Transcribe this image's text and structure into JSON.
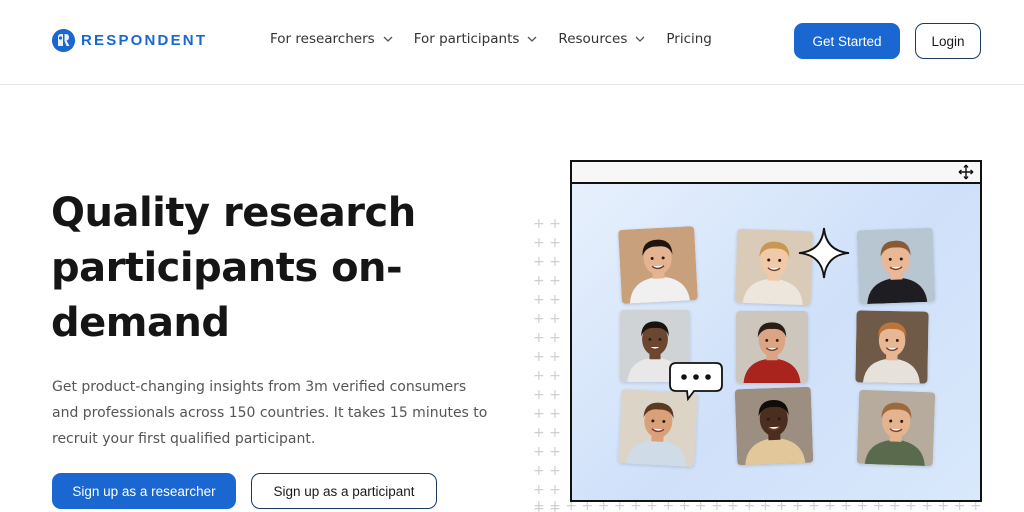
{
  "brand": {
    "name": "RESPONDENT",
    "color": "#1a67d2"
  },
  "nav": {
    "items": [
      {
        "label": "For researchers",
        "has_dropdown": true
      },
      {
        "label": "For participants",
        "has_dropdown": true
      },
      {
        "label": "Resources",
        "has_dropdown": true
      },
      {
        "label": "Pricing",
        "has_dropdown": false
      }
    ],
    "get_started": "Get Started",
    "login": "Login"
  },
  "hero": {
    "title_line1": "Quality research",
    "title_line2": "participants on-",
    "title_line3": "demand",
    "subtitle": "Get product-changing insights from 3m verified consumers and professionals across 150 countries. It takes 15 minutes to recruit your first qualified participant.",
    "cta_researcher": "Sign up as a researcher",
    "cta_participant": "Sign up as a participant"
  },
  "illustration": {
    "participants": [
      {
        "name": "participant-photo-1",
        "skin": "#e3b48f",
        "hair": "#1f140e",
        "shirt": "#f0f0f0",
        "bg": "#c9a07c"
      },
      {
        "name": "participant-photo-2",
        "skin": "#f0c9a8",
        "hair": "#c9974f",
        "shirt": "#ede6dc",
        "bg": "#d9cbb8"
      },
      {
        "name": "participant-photo-3",
        "skin": "#e9b896",
        "hair": "#8a5a34",
        "shirt": "#1e1e22",
        "bg": "#b8c6d2"
      },
      {
        "name": "participant-photo-4",
        "skin": "#6b4630",
        "hair": "#1a1410",
        "shirt": "#e8e8e8",
        "bg": "#cfd3d6"
      },
      {
        "name": "participant-photo-5",
        "skin": "#dba483",
        "hair": "#2a1d14",
        "shirt": "#a8241d",
        "bg": "#cdc6bd"
      },
      {
        "name": "participant-photo-6",
        "skin": "#e9b693",
        "hair": "#b9753b",
        "shirt": "#e6e1da",
        "bg": "#6f5a48"
      },
      {
        "name": "participant-photo-7",
        "skin": "#d9a079",
        "hair": "#5a3a22",
        "shirt": "#cfdbe6",
        "bg": "#dcd4c6"
      },
      {
        "name": "participant-photo-8",
        "skin": "#4a2e1f",
        "hair": "#120c08",
        "shirt": "#e2c79a",
        "bg": "#9c8f82"
      },
      {
        "name": "participant-photo-9",
        "skin": "#e6b38f",
        "hair": "#9c6a3c",
        "shirt": "#5a6a4c",
        "bg": "#b6ab9c"
      }
    ]
  }
}
